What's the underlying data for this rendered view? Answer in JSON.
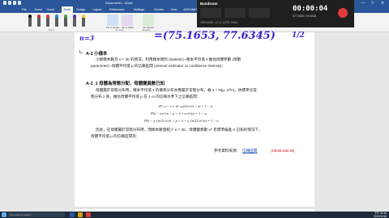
{
  "window": {
    "title": "Document1 - Word",
    "controls": {
      "minimize": "—",
      "maximize": "□",
      "close": "✕"
    }
  },
  "ribbon": {
    "tabs": [
      "File",
      "Home",
      "Insert",
      "Draw",
      "Design",
      "Layout",
      "References",
      "Mailings",
      "Review",
      "View",
      "ACROBAT"
    ],
    "active_tab": "Draw",
    "pen_colors": [
      "#1a1a1a",
      "#d32f2f",
      "#e53935",
      "#1e88e5",
      "#43a047",
      "#5e35b1",
      "#fbc02d"
    ],
    "buttons": [
      {
        "label": "Ink to\nShape"
      },
      {
        "label": "Ink to\nMath"
      },
      {
        "label": "Ink\nReplay"
      }
    ],
    "groups": [
      "Pens",
      "Convert",
      "Replay"
    ]
  },
  "recorder": {
    "app": "Bandicam",
    "tabs": [
      "Screen",
      "Game",
      "Device"
    ],
    "time": "00:00:04",
    "size": "577.6KB / 99.8GB",
    "info": "1920x1080 - (0, 0), (1279, 1080)",
    "colors": {
      "stop": "#e23b3b"
    }
  },
  "document": {
    "handwritten_top": "=(75.1653, 77.6345)",
    "handwritten_left": "n=3",
    "handwritten_right": "1/2",
    "section1_head": "A-2  小樣本",
    "section1_body": [
      "小樣樣本數為 n < 30 的情況，利用樣本資料 (statistic)─樣本平均值 x̄ 推估母體參數 (母數",
      "parameter)─母體平均值 μ 的信賴區間 (interval estimator or confidence interval)："
    ],
    "section2_head": "A-2_1   母體為常態分配，母體變異數已知",
    "section2_body": [
      "母體屬於常態分布時，樣本平均值 x̄ 的機率分布亦應屬於常態分布，故 x̄ ~ N(μ, σ²/n)，依標準化常",
      "態分布 z 值，推估母體平均值 μ 在 1−α 的信賴水準下之信賴區間："
    ],
    "formulas": [
      "P(−z < z = (x̄−μ)/(σ/√n) < z) = 1 − α",
      "P(x̄ − z·σ/√n < μ < x̄ + z·σ/√n) = 1 − α",
      "P(x̄ − z_{α/2}·σ/√n < μ < x̄ + z_{α/2}·σ/√n) = 1 − α"
    ],
    "section2_tail": [
      "因此，在母體屬於常態分布時，而樣本數量較少 n < 30，母體變異數 σ² 有標準偏差 σ 已知的情況下，",
      "母體平均值 μ 的信賴區間為："
    ],
    "reference_label": "參考資料來源：",
    "reference_link": "信賴區間",
    "reference_site": "[nkust.edu.tw]"
  },
  "taskbar": {
    "search": "Type here to search",
    "time": "下午 02:18",
    "date": "2021/11/16",
    "colors": {
      "bg": "#1c2a3a"
    }
  }
}
